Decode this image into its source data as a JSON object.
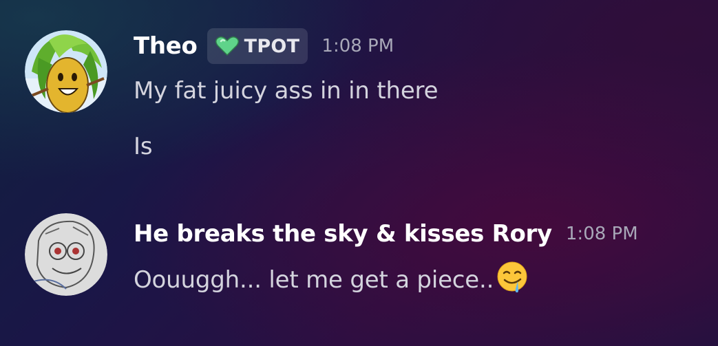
{
  "messages": [
    {
      "username": "Theo",
      "tag": {
        "icon": "green-heart-icon",
        "label": "TPOT",
        "color": "#5fd38a"
      },
      "timestamp": "1:08 PM",
      "lines": [
        "My fat juicy ass in in there",
        "Is"
      ]
    },
    {
      "username": "He breaks the sky & kisses Rory",
      "timestamp": "1:08 PM",
      "lines": [
        "Oouuggh... let me get a piece.."
      ],
      "trailing_emoji": "drooling-face-icon"
    }
  ]
}
